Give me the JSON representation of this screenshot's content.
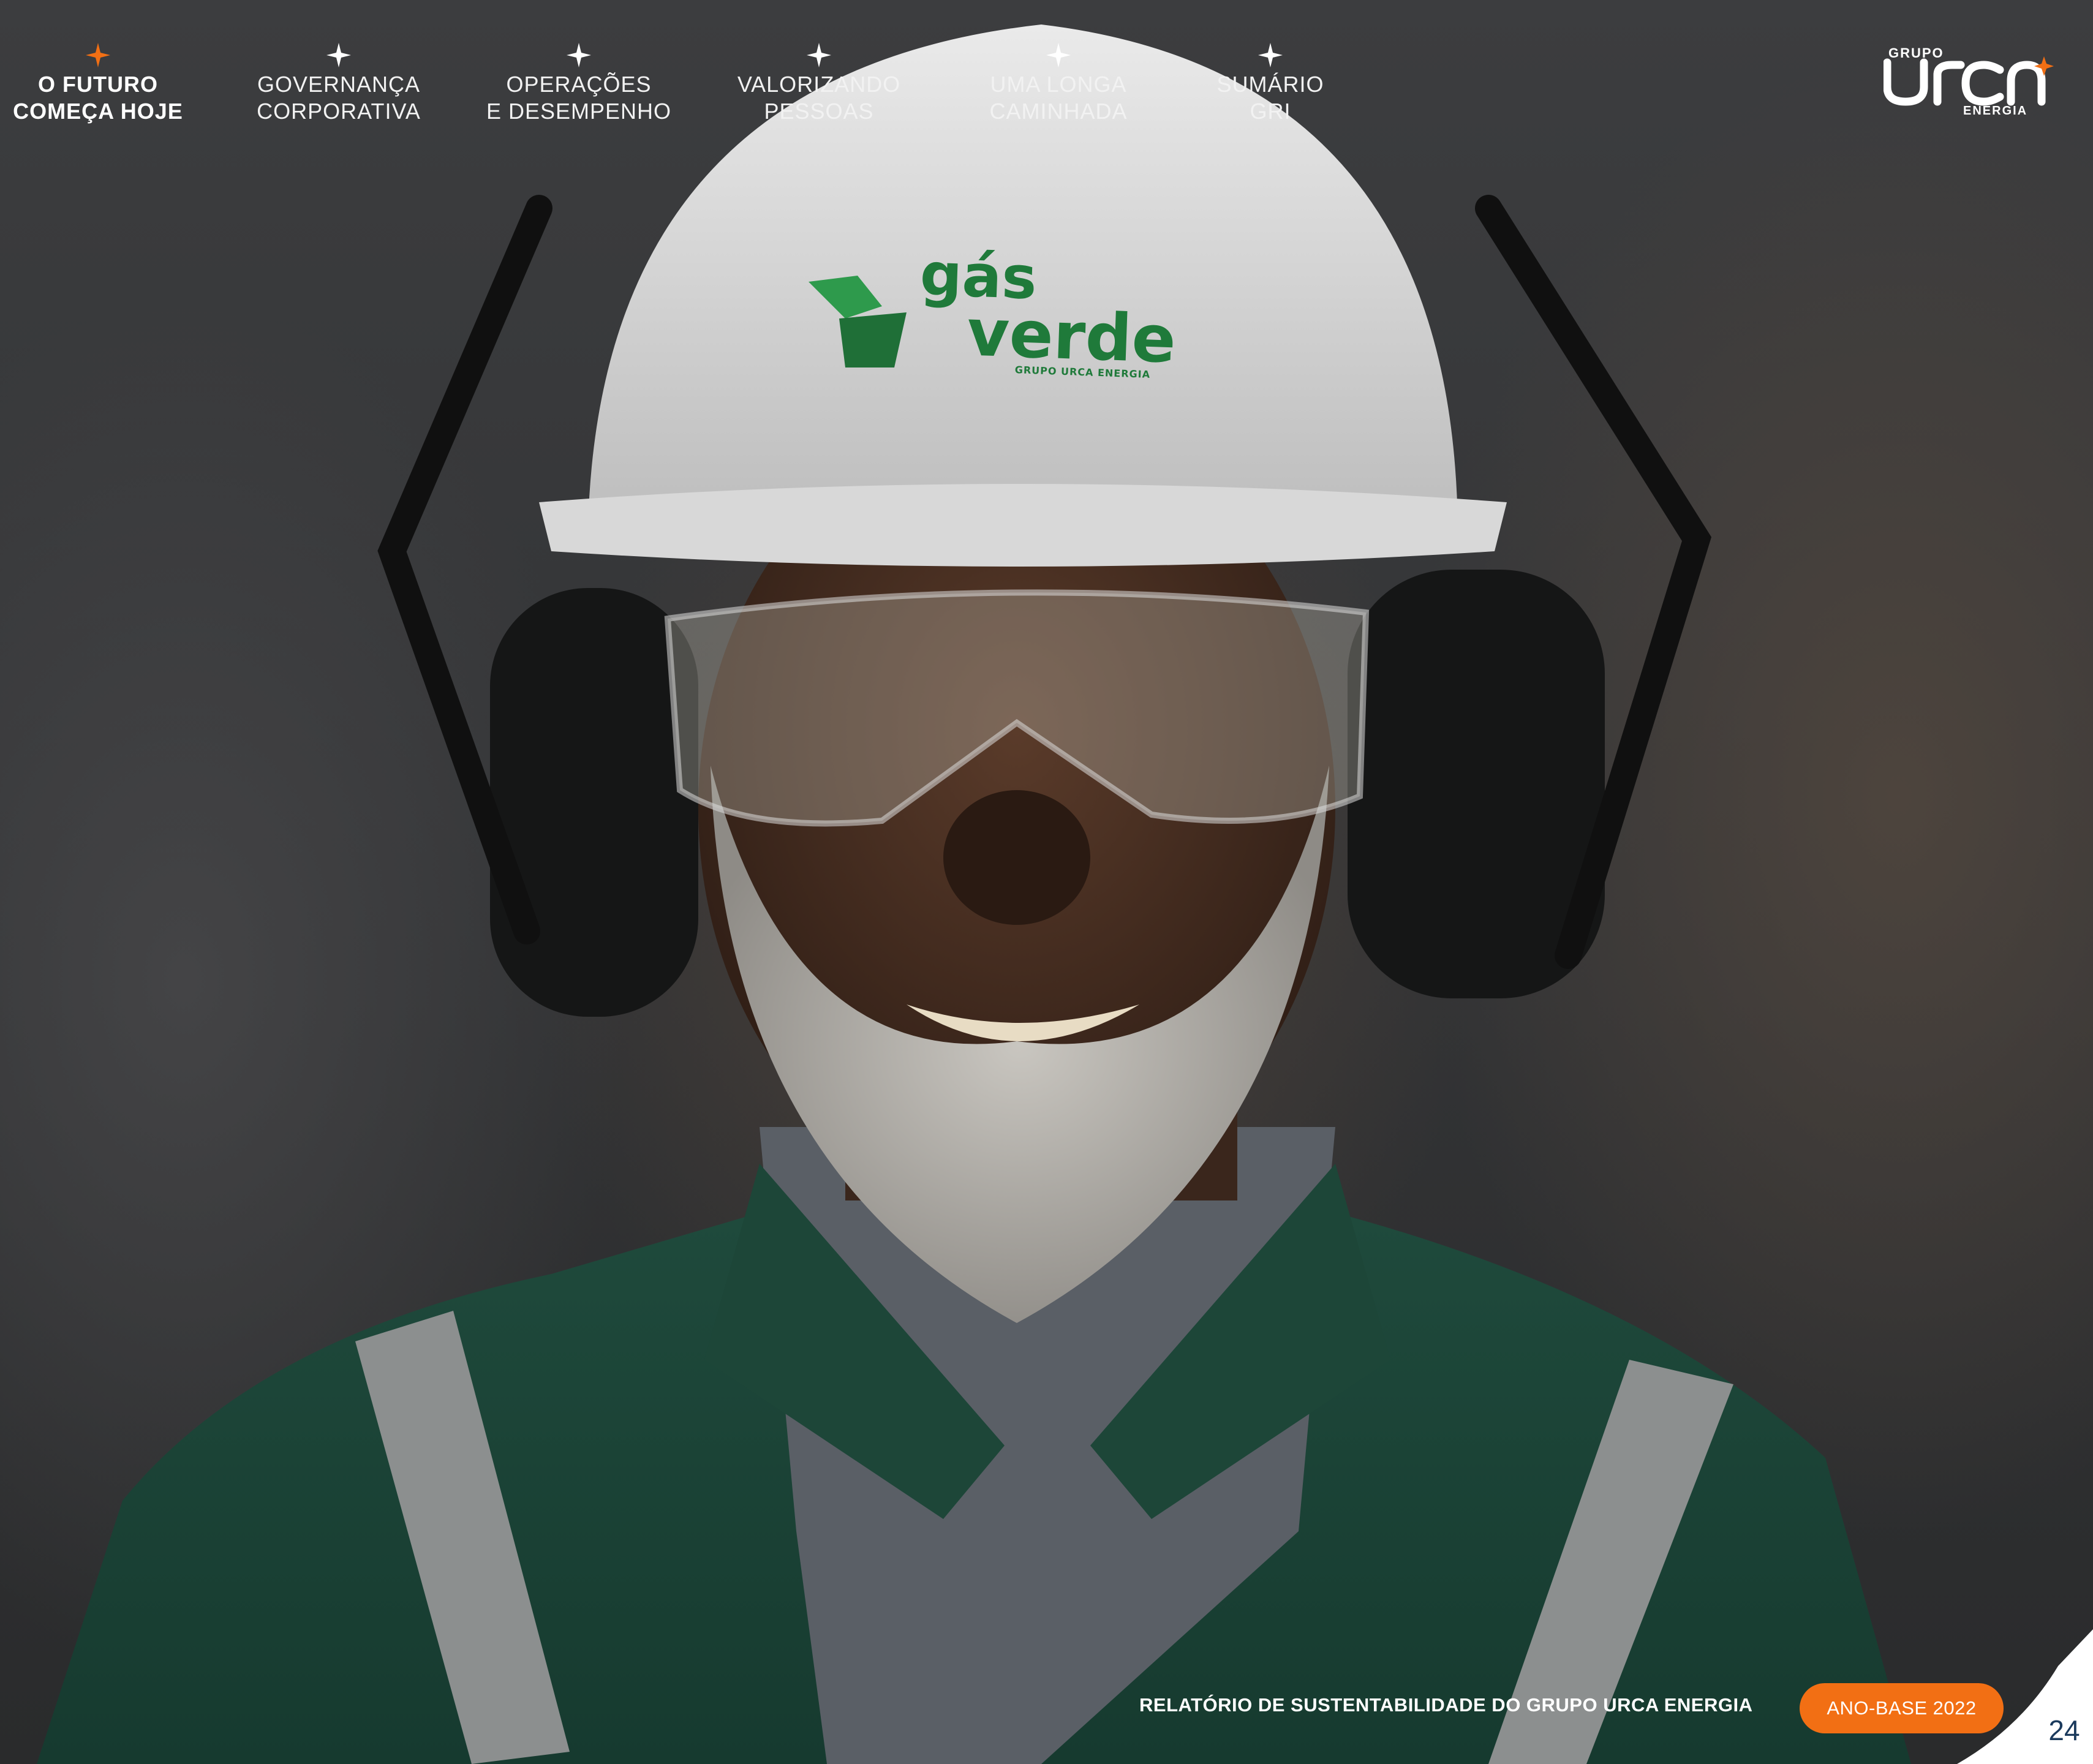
{
  "nav": {
    "items": [
      {
        "label": "O FUTURO\nCOMEÇA HOJE",
        "active": true
      },
      {
        "label": "GOVERNANÇA\nCORPORATIVA",
        "active": false
      },
      {
        "label": "OPERAÇÕES\nE DESEMPENHO",
        "active": false
      },
      {
        "label": "VALORIZANDO\nPESSOAS",
        "active": false
      },
      {
        "label": "UMA LONGA\nCAMINHADA",
        "active": false
      },
      {
        "label": "SUMÁRIO\nGRI",
        "active": false
      }
    ],
    "active_color": "#f26f14",
    "inactive_color": "#ffffff",
    "icon": "star-icon"
  },
  "logo": {
    "grupo": "GRUPO",
    "brand": "URCA",
    "energia": "ENERGIA",
    "accent_color": "#f26f14"
  },
  "helmet": {
    "brand_line1": "gás",
    "brand_line2": "verde",
    "sub": "GRUPO URCA ENERGIA",
    "brand_color": "#1f7a3a"
  },
  "footer": {
    "report_title": "RELATÓRIO DE SUSTENTABILIDADE DO GRUPO URCA ENERGIA",
    "year_badge": "ANO-BASE 2022",
    "page_number": "24",
    "badge_color": "#f26f14"
  }
}
